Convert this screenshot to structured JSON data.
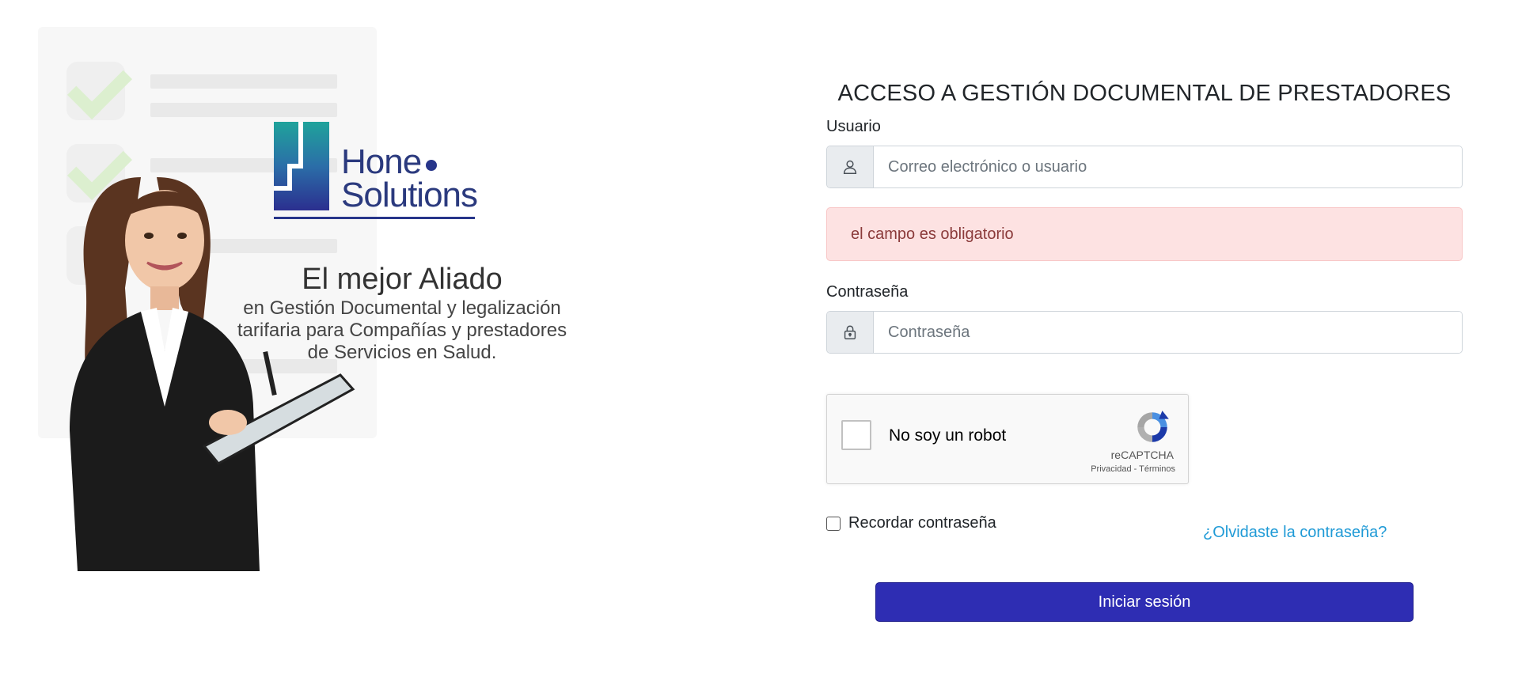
{
  "promo": {
    "logo": {
      "line1": "Hone",
      "line2": "Solutions"
    },
    "tagline": {
      "title": "El mejor Aliado",
      "line1": "en Gestión Documental y legalización",
      "line2": "tarifaria para Compañías y prestadores",
      "line3": "de Servicios en Salud."
    }
  },
  "form": {
    "title": "ACCESO A GESTIÓN DOCUMENTAL DE PRESTADORES",
    "username": {
      "label": "Usuario",
      "placeholder": "Correo electrónico o usuario",
      "value": ""
    },
    "error": "el campo es obligatorio",
    "password": {
      "label": "Contraseña",
      "placeholder": "Contraseña",
      "value": ""
    },
    "recaptcha": {
      "label": "No soy un robot",
      "brand": "reCAPTCHA",
      "links": "Privacidad - Términos"
    },
    "remember_label": "Recordar contraseña",
    "forgot_link": "¿Olvidaste la contraseña?",
    "submit_label": "Iniciar sesión"
  },
  "colors": {
    "primary_button": "#2e2db3",
    "link": "#1f9ad6",
    "alert_bg": "#fde2e2",
    "alert_text": "#8a3a3a"
  },
  "icons": {
    "username": "user-icon",
    "password": "lock-icon",
    "recaptcha": "recaptcha-logo-icon"
  }
}
